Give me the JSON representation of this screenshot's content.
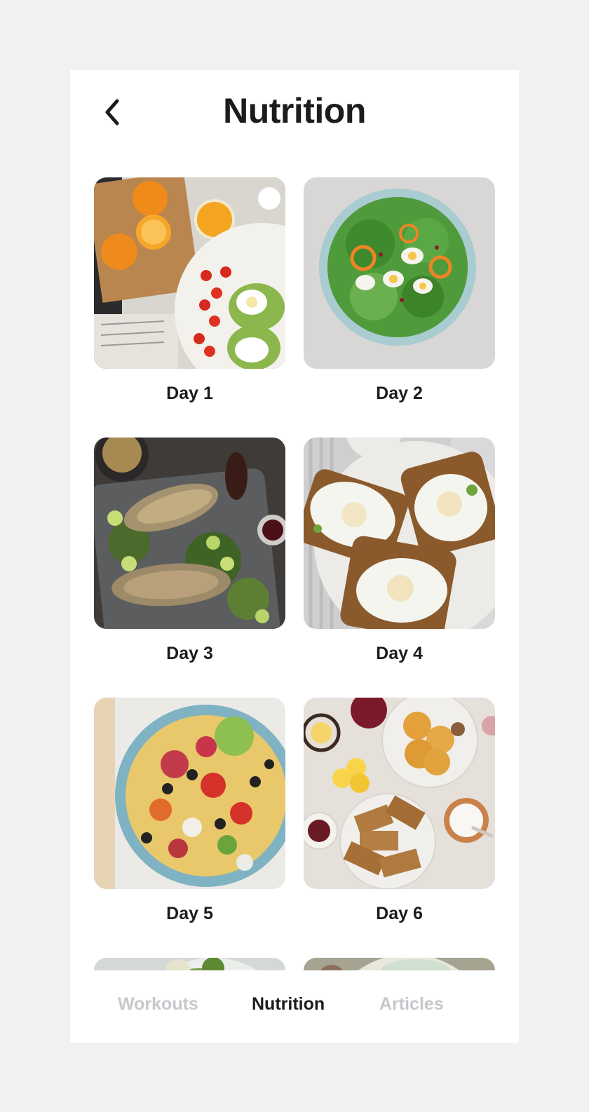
{
  "header": {
    "title": "Nutrition",
    "back_icon": "chevron-left-icon"
  },
  "days": [
    {
      "label": "Day 1",
      "image": "breakfast-oranges-avocado-toast"
    },
    {
      "label": "Day 2",
      "image": "green-salad-eggs"
    },
    {
      "label": "Day 3",
      "image": "grilled-fish-tray"
    },
    {
      "label": "Day 4",
      "image": "fried-egg-toasts"
    },
    {
      "label": "Day 5",
      "image": "pasta-salad-bowl"
    },
    {
      "label": "Day 6",
      "image": "pancakes-french-toast"
    }
  ],
  "tabs": [
    {
      "label": "Workouts",
      "active": false
    },
    {
      "label": "Nutrition",
      "active": true
    },
    {
      "label": "Articles",
      "active": false
    }
  ],
  "colors": {
    "background": "#f1f1f2",
    "text": "#1c1c1e",
    "inactive_tab": "#c7c7cc"
  }
}
